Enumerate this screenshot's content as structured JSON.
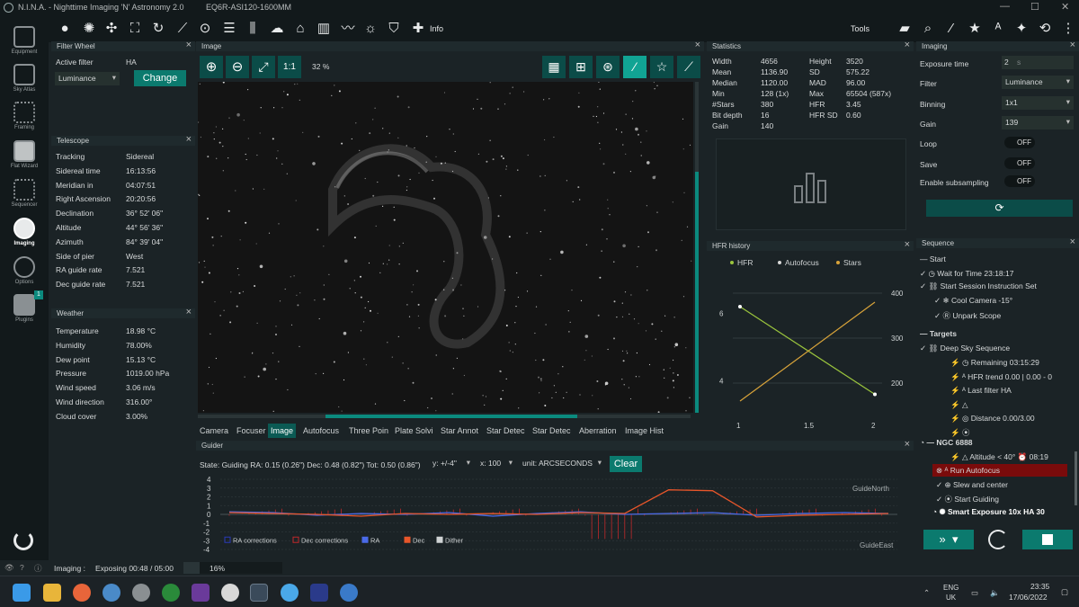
{
  "window": {
    "title": "N.I.N.A. - Nighttime Imaging 'N' Astronomy 2.0",
    "profile": "EQ6R-ASI120-1600MM",
    "minimize": "—",
    "maximize": "☐",
    "close": "✕"
  },
  "toolbar": {
    "info_label": "Info",
    "tools_label": "Tools"
  },
  "sidebar": {
    "items": [
      {
        "label": "Equipment",
        "icon": "telescope-icon"
      },
      {
        "label": "Sky Atlas",
        "icon": "map-icon"
      },
      {
        "label": "Framing",
        "icon": "framing-icon"
      },
      {
        "label": "Flat Wizard",
        "icon": "flat-wizard-icon"
      },
      {
        "label": "Sequencer",
        "icon": "sequencer-icon"
      },
      {
        "label": "Imaging",
        "icon": "imaging-icon"
      },
      {
        "label": "Options",
        "icon": "gears-icon"
      },
      {
        "label": "Plugins",
        "icon": "puzzle-icon",
        "badge": "1"
      }
    ]
  },
  "filter_wheel": {
    "title": "Filter Wheel",
    "active_label": "Active filter",
    "active_value": "HA",
    "selected": "Luminance",
    "change_label": "Change"
  },
  "telescope": {
    "title": "Telescope",
    "rows": [
      [
        "Tracking",
        "Sidereal"
      ],
      [
        "Sidereal time",
        "16:13:56"
      ],
      [
        "Meridian in",
        "04:07:51"
      ],
      [
        "Right Ascension",
        "20:20:56"
      ],
      [
        "Declination",
        "36° 52' 06\""
      ],
      [
        "Altitude",
        "44° 56' 36\""
      ],
      [
        "Azimuth",
        "84° 39' 04\""
      ],
      [
        "Side of pier",
        "West"
      ],
      [
        "RA guide rate",
        "7.521"
      ],
      [
        "Dec guide rate",
        "7.521"
      ]
    ]
  },
  "weather": {
    "title": "Weather",
    "rows": [
      [
        "Temperature",
        "18.98 °C"
      ],
      [
        "Humidity",
        "78.00%"
      ],
      [
        "Dew point",
        "15.13 °C"
      ],
      [
        "Pressure",
        "1019.00 hPa"
      ],
      [
        "Wind speed",
        "3.06 m/s"
      ],
      [
        "Wind direction",
        "316.00°"
      ],
      [
        "Cloud cover",
        "3.00%"
      ]
    ]
  },
  "image": {
    "title": "Image",
    "zoom_fit": "1:1",
    "zoom_pct": "32 %"
  },
  "tabs": [
    "Camera",
    "Focuser",
    "Image",
    "Autofocus",
    "Three Poin",
    "Plate Solvi",
    "Star Annot",
    "Star Detec",
    "Star Detec",
    "Aberration",
    "Image Hist"
  ],
  "statistics": {
    "title": "Statistics",
    "left": [
      [
        "Width",
        "4656"
      ],
      [
        "Mean",
        "1136.90"
      ],
      [
        "Median",
        "1120.00"
      ],
      [
        "Min",
        "128 (1x)"
      ],
      [
        "#Stars",
        "380"
      ],
      [
        "Bit depth",
        "16"
      ],
      [
        "Gain",
        "140"
      ]
    ],
    "right": [
      [
        "Height",
        "3520"
      ],
      [
        "SD",
        "575.22"
      ],
      [
        "MAD",
        "96.00"
      ],
      [
        "Max",
        "65504 (587x)"
      ],
      [
        "HFR",
        "3.45"
      ],
      [
        "HFR SD",
        "0.60"
      ]
    ]
  },
  "hfr_history": {
    "title": "HFR history",
    "legend": [
      "HFR",
      "Autofocus",
      "Stars"
    ]
  },
  "imaging": {
    "title": "Imaging",
    "rows": [
      {
        "label": "Exposure time",
        "value": "2",
        "unit": "s"
      },
      {
        "label": "Filter",
        "value": "Luminance"
      },
      {
        "label": "Binning",
        "value": "1x1"
      },
      {
        "label": "Gain",
        "value": "139"
      },
      {
        "label": "Loop",
        "value": "OFF"
      },
      {
        "label": "Save",
        "value": "OFF"
      },
      {
        "label": "Enable subsampling",
        "value": "OFF"
      }
    ]
  },
  "sequence": {
    "title": "Sequence",
    "items": [
      {
        "t": "Start"
      },
      {
        "t": "Wait for Time  23:18:17"
      },
      {
        "t": "Start Session Instruction Set"
      },
      {
        "t": "Cool Camera  -15°"
      },
      {
        "t": "Unpark Scope"
      },
      {
        "t": "Targets"
      },
      {
        "t": "Deep Sky Sequence"
      },
      {
        "t": "Remaining 03:15:29"
      },
      {
        "t": "HFR trend  0.00 | 0.00 - 0"
      },
      {
        "t": "Last filter HA"
      },
      {
        "t": "Distance  0.00/3.00"
      },
      {
        "t": "NGC 6888"
      },
      {
        "t": "Altitude < 40°"
      },
      {
        "t": "08:19"
      },
      {
        "t": "Run Autofocus"
      },
      {
        "t": "Slew and center"
      },
      {
        "t": "Start Guiding"
      },
      {
        "t": "Smart Exposure  10x  HA  30"
      }
    ]
  },
  "guider": {
    "title": "Guider",
    "state": "State: Guiding  RA: 0.15 (0.26\")  Dec: 0.48 (0.82\")  Tot: 0.50 (0.86\")",
    "y_scale": "y: +/-4\"",
    "x_scale": "x: 100",
    "unit": "unit: ARCSECONDS",
    "clear_label": "Clear",
    "north": "GuideNorth",
    "east": "GuideEast",
    "legend": [
      "RA corrections",
      "Dec corrections",
      "RA",
      "Dec",
      "Dither"
    ]
  },
  "status": {
    "module": "Imaging :",
    "text": "Exposing 00:48 / 05:00",
    "progress_pct": "16%",
    "progress_fraction": 0.16
  },
  "taskbar": {
    "lang": "ENG",
    "region": "UK",
    "time": "23:35",
    "date": "17/06/2022"
  },
  "chart_data": [
    {
      "type": "line",
      "title": "HFR history",
      "x": [
        1,
        2
      ],
      "series": [
        {
          "name": "HFR",
          "values": [
            6.2,
            3.6
          ]
        },
        {
          "name": "Stars",
          "values": [
            160,
            380
          ]
        }
      ],
      "y_ticks_left": [
        "6",
        "4"
      ],
      "y_ticks_right": [
        "400",
        "300",
        "200"
      ],
      "x_ticks": [
        "1",
        "1.5",
        "2"
      ]
    },
    {
      "type": "line",
      "title": "Guider",
      "xlim": [
        0,
        100
      ],
      "ylim": [
        -4,
        4
      ],
      "y_ticks": [
        "4",
        "3",
        "2",
        "1",
        "0",
        "-1",
        "-2",
        "-3",
        "-4"
      ],
      "series": [
        {
          "name": "RA",
          "values": [
            0.3,
            0.2,
            -0.1,
            0.1,
            0,
            0.2,
            -0.2,
            0.1,
            0.3,
            0,
            0.1,
            0.2,
            -0.1,
            0.1,
            0.2,
            0.1
          ]
        },
        {
          "name": "Dec",
          "values": [
            0.2,
            0.1,
            0,
            -0.2,
            0.1,
            0,
            0.1,
            0,
            0.2,
            0.1,
            2.8,
            2.7,
            -0.3,
            -0.1,
            0,
            0.1
          ]
        }
      ]
    }
  ]
}
